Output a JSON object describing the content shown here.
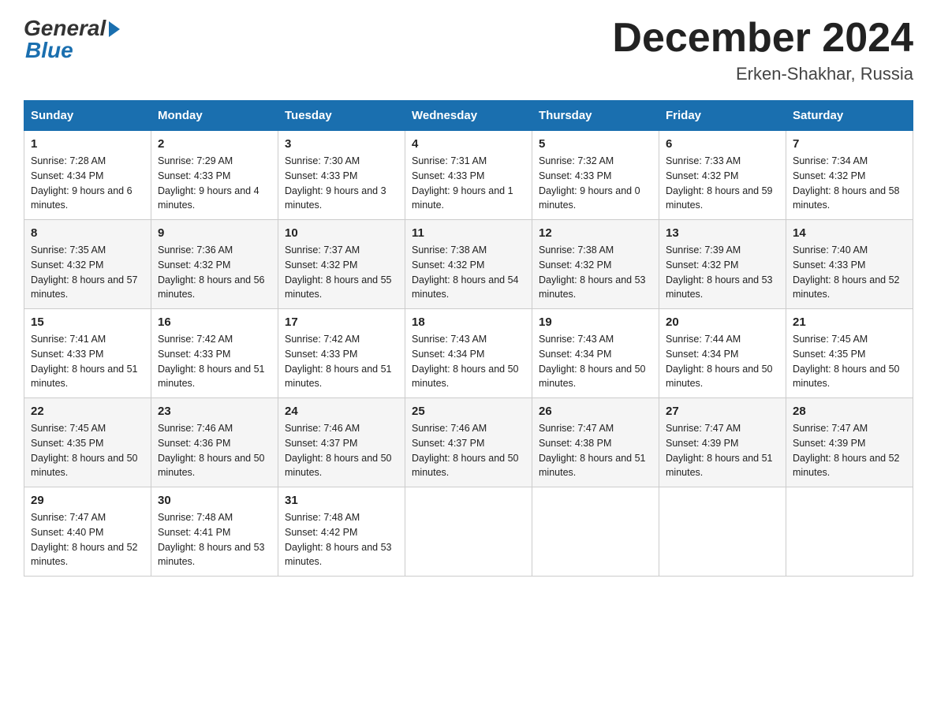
{
  "header": {
    "logo_general": "General",
    "logo_blue": "Blue",
    "month_title": "December 2024",
    "location": "Erken-Shakhar, Russia"
  },
  "days_of_week": [
    "Sunday",
    "Monday",
    "Tuesday",
    "Wednesday",
    "Thursday",
    "Friday",
    "Saturday"
  ],
  "weeks": [
    [
      {
        "day": "1",
        "sunrise": "7:28 AM",
        "sunset": "4:34 PM",
        "daylight": "9 hours and 6 minutes."
      },
      {
        "day": "2",
        "sunrise": "7:29 AM",
        "sunset": "4:33 PM",
        "daylight": "9 hours and 4 minutes."
      },
      {
        "day": "3",
        "sunrise": "7:30 AM",
        "sunset": "4:33 PM",
        "daylight": "9 hours and 3 minutes."
      },
      {
        "day": "4",
        "sunrise": "7:31 AM",
        "sunset": "4:33 PM",
        "daylight": "9 hours and 1 minute."
      },
      {
        "day": "5",
        "sunrise": "7:32 AM",
        "sunset": "4:33 PM",
        "daylight": "9 hours and 0 minutes."
      },
      {
        "day": "6",
        "sunrise": "7:33 AM",
        "sunset": "4:32 PM",
        "daylight": "8 hours and 59 minutes."
      },
      {
        "day": "7",
        "sunrise": "7:34 AM",
        "sunset": "4:32 PM",
        "daylight": "8 hours and 58 minutes."
      }
    ],
    [
      {
        "day": "8",
        "sunrise": "7:35 AM",
        "sunset": "4:32 PM",
        "daylight": "8 hours and 57 minutes."
      },
      {
        "day": "9",
        "sunrise": "7:36 AM",
        "sunset": "4:32 PM",
        "daylight": "8 hours and 56 minutes."
      },
      {
        "day": "10",
        "sunrise": "7:37 AM",
        "sunset": "4:32 PM",
        "daylight": "8 hours and 55 minutes."
      },
      {
        "day": "11",
        "sunrise": "7:38 AM",
        "sunset": "4:32 PM",
        "daylight": "8 hours and 54 minutes."
      },
      {
        "day": "12",
        "sunrise": "7:38 AM",
        "sunset": "4:32 PM",
        "daylight": "8 hours and 53 minutes."
      },
      {
        "day": "13",
        "sunrise": "7:39 AM",
        "sunset": "4:32 PM",
        "daylight": "8 hours and 53 minutes."
      },
      {
        "day": "14",
        "sunrise": "7:40 AM",
        "sunset": "4:33 PM",
        "daylight": "8 hours and 52 minutes."
      }
    ],
    [
      {
        "day": "15",
        "sunrise": "7:41 AM",
        "sunset": "4:33 PM",
        "daylight": "8 hours and 51 minutes."
      },
      {
        "day": "16",
        "sunrise": "7:42 AM",
        "sunset": "4:33 PM",
        "daylight": "8 hours and 51 minutes."
      },
      {
        "day": "17",
        "sunrise": "7:42 AM",
        "sunset": "4:33 PM",
        "daylight": "8 hours and 51 minutes."
      },
      {
        "day": "18",
        "sunrise": "7:43 AM",
        "sunset": "4:34 PM",
        "daylight": "8 hours and 50 minutes."
      },
      {
        "day": "19",
        "sunrise": "7:43 AM",
        "sunset": "4:34 PM",
        "daylight": "8 hours and 50 minutes."
      },
      {
        "day": "20",
        "sunrise": "7:44 AM",
        "sunset": "4:34 PM",
        "daylight": "8 hours and 50 minutes."
      },
      {
        "day": "21",
        "sunrise": "7:45 AM",
        "sunset": "4:35 PM",
        "daylight": "8 hours and 50 minutes."
      }
    ],
    [
      {
        "day": "22",
        "sunrise": "7:45 AM",
        "sunset": "4:35 PM",
        "daylight": "8 hours and 50 minutes."
      },
      {
        "day": "23",
        "sunrise": "7:46 AM",
        "sunset": "4:36 PM",
        "daylight": "8 hours and 50 minutes."
      },
      {
        "day": "24",
        "sunrise": "7:46 AM",
        "sunset": "4:37 PM",
        "daylight": "8 hours and 50 minutes."
      },
      {
        "day": "25",
        "sunrise": "7:46 AM",
        "sunset": "4:37 PM",
        "daylight": "8 hours and 50 minutes."
      },
      {
        "day": "26",
        "sunrise": "7:47 AM",
        "sunset": "4:38 PM",
        "daylight": "8 hours and 51 minutes."
      },
      {
        "day": "27",
        "sunrise": "7:47 AM",
        "sunset": "4:39 PM",
        "daylight": "8 hours and 51 minutes."
      },
      {
        "day": "28",
        "sunrise": "7:47 AM",
        "sunset": "4:39 PM",
        "daylight": "8 hours and 52 minutes."
      }
    ],
    [
      {
        "day": "29",
        "sunrise": "7:47 AM",
        "sunset": "4:40 PM",
        "daylight": "8 hours and 52 minutes."
      },
      {
        "day": "30",
        "sunrise": "7:48 AM",
        "sunset": "4:41 PM",
        "daylight": "8 hours and 53 minutes."
      },
      {
        "day": "31",
        "sunrise": "7:48 AM",
        "sunset": "4:42 PM",
        "daylight": "8 hours and 53 minutes."
      },
      null,
      null,
      null,
      null
    ]
  ]
}
